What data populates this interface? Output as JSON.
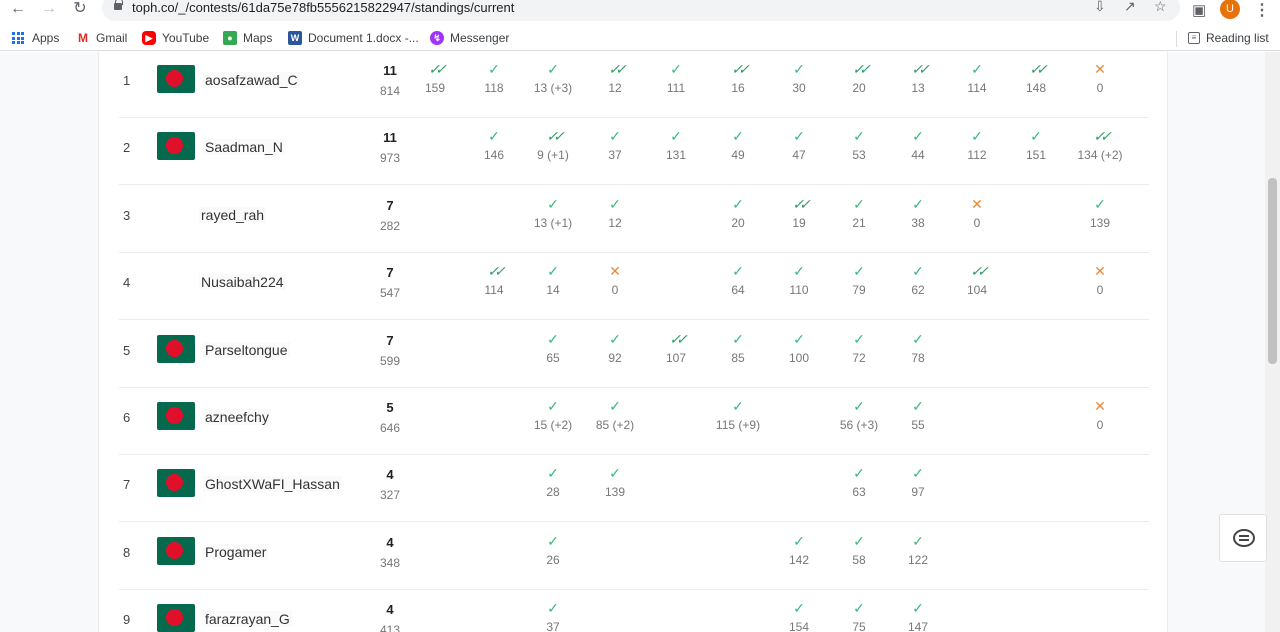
{
  "browser": {
    "url": "toph.co/_/contests/61da75e78fb5556215822947/standings/current",
    "profile_initial": "U",
    "bookmarks": [
      "Apps",
      "Gmail",
      "YouTube",
      "Maps",
      "Document 1.docx -...",
      "Messenger"
    ],
    "reading_list": "Reading list"
  },
  "colors": {
    "accepted": "#3cb87c",
    "first_solve": "#2c9d64",
    "wrong": "#e8893a",
    "flag_green": "#05694d",
    "flag_red": "#e0102b"
  },
  "standings": [
    {
      "rank": "1",
      "name": "aosafzawad_C",
      "flag": true,
      "solved": "11",
      "penalty": "814",
      "cells": [
        {
          "col": 0,
          "status": "first",
          "value": "159"
        },
        {
          "col": 1,
          "status": "ok",
          "value": "118"
        },
        {
          "col": 2,
          "status": "ok",
          "value": "13 (+3)"
        },
        {
          "col": 3,
          "status": "first",
          "value": "12"
        },
        {
          "col": 4,
          "status": "ok",
          "value": "111"
        },
        {
          "col": 5,
          "status": "first",
          "value": "16"
        },
        {
          "col": 6,
          "status": "ok",
          "value": "30"
        },
        {
          "col": 7,
          "status": "first",
          "value": "20"
        },
        {
          "col": 8,
          "status": "first",
          "value": "13"
        },
        {
          "col": 9,
          "status": "ok",
          "value": "114"
        },
        {
          "col": 10,
          "status": "first",
          "value": "148"
        },
        {
          "col": 11,
          "status": "fail",
          "value": "0"
        }
      ]
    },
    {
      "rank": "2",
      "name": "Saadman_N",
      "flag": true,
      "solved": "11",
      "penalty": "973",
      "cells": [
        {
          "col": 1,
          "status": "ok",
          "value": "146"
        },
        {
          "col": 2,
          "status": "first",
          "value": "9 (+1)"
        },
        {
          "col": 3,
          "status": "ok",
          "value": "37"
        },
        {
          "col": 4,
          "status": "ok",
          "value": "131"
        },
        {
          "col": 5,
          "status": "ok",
          "value": "49"
        },
        {
          "col": 6,
          "status": "ok",
          "value": "47"
        },
        {
          "col": 7,
          "status": "ok",
          "value": "53"
        },
        {
          "col": 8,
          "status": "ok",
          "value": "44"
        },
        {
          "col": 9,
          "status": "ok",
          "value": "112"
        },
        {
          "col": 10,
          "status": "ok",
          "value": "151"
        },
        {
          "col": 11,
          "status": "first",
          "value": "134 (+2)"
        }
      ]
    },
    {
      "rank": "3",
      "name": "rayed_rah",
      "flag": false,
      "solved": "7",
      "penalty": "282",
      "cells": [
        {
          "col": 2,
          "status": "ok",
          "value": "13 (+1)"
        },
        {
          "col": 3,
          "status": "ok",
          "value": "12"
        },
        {
          "col": 5,
          "status": "ok",
          "value": "20"
        },
        {
          "col": 6,
          "status": "first",
          "value": "19"
        },
        {
          "col": 7,
          "status": "ok",
          "value": "21"
        },
        {
          "col": 8,
          "status": "ok",
          "value": "38"
        },
        {
          "col": 9,
          "status": "fail",
          "value": "0"
        },
        {
          "col": 11,
          "status": "ok",
          "value": "139"
        }
      ]
    },
    {
      "rank": "4",
      "name": "Nusaibah224",
      "flag": false,
      "solved": "7",
      "penalty": "547",
      "cells": [
        {
          "col": 1,
          "status": "first",
          "value": "114"
        },
        {
          "col": 2,
          "status": "ok",
          "value": "14"
        },
        {
          "col": 3,
          "status": "fail",
          "value": "0"
        },
        {
          "col": 5,
          "status": "ok",
          "value": "64"
        },
        {
          "col": 6,
          "status": "ok",
          "value": "110"
        },
        {
          "col": 7,
          "status": "ok",
          "value": "79"
        },
        {
          "col": 8,
          "status": "ok",
          "value": "62"
        },
        {
          "col": 9,
          "status": "first",
          "value": "104"
        },
        {
          "col": 11,
          "status": "fail",
          "value": "0"
        }
      ]
    },
    {
      "rank": "5",
      "name": "Parseltongue",
      "flag": true,
      "solved": "7",
      "penalty": "599",
      "cells": [
        {
          "col": 2,
          "status": "ok",
          "value": "65"
        },
        {
          "col": 3,
          "status": "ok",
          "value": "92"
        },
        {
          "col": 4,
          "status": "first",
          "value": "107"
        },
        {
          "col": 5,
          "status": "ok",
          "value": "85"
        },
        {
          "col": 6,
          "status": "ok",
          "value": "100"
        },
        {
          "col": 7,
          "status": "ok",
          "value": "72"
        },
        {
          "col": 8,
          "status": "ok",
          "value": "78"
        }
      ]
    },
    {
      "rank": "6",
      "name": "azneefchy",
      "flag": true,
      "solved": "5",
      "penalty": "646",
      "cells": [
        {
          "col": 2,
          "status": "ok",
          "value": "15 (+2)"
        },
        {
          "col": 3,
          "status": "ok",
          "value": "85 (+2)"
        },
        {
          "col": 5,
          "status": "ok",
          "value": "115 (+9)"
        },
        {
          "col": 7,
          "status": "ok",
          "value": "56 (+3)"
        },
        {
          "col": 8,
          "status": "ok",
          "value": "55"
        },
        {
          "col": 11,
          "status": "fail",
          "value": "0"
        }
      ]
    },
    {
      "rank": "7",
      "name": "GhostXWaFI_Hassan",
      "flag": true,
      "solved": "4",
      "penalty": "327",
      "cells": [
        {
          "col": 2,
          "status": "ok",
          "value": "28"
        },
        {
          "col": 3,
          "status": "ok",
          "value": "139"
        },
        {
          "col": 7,
          "status": "ok",
          "value": "63"
        },
        {
          "col": 8,
          "status": "ok",
          "value": "97"
        }
      ]
    },
    {
      "rank": "8",
      "name": "Progamer",
      "flag": true,
      "solved": "4",
      "penalty": "348",
      "cells": [
        {
          "col": 2,
          "status": "ok",
          "value": "26"
        },
        {
          "col": 6,
          "status": "ok",
          "value": "142"
        },
        {
          "col": 7,
          "status": "ok",
          "value": "58"
        },
        {
          "col": 8,
          "status": "ok",
          "value": "122"
        }
      ]
    },
    {
      "rank": "9",
      "name": "farazrayan_G",
      "flag": true,
      "solved": "4",
      "penalty": "413",
      "cells": [
        {
          "col": 2,
          "status": "ok",
          "value": "37"
        },
        {
          "col": 6,
          "status": "ok",
          "value": "154"
        },
        {
          "col": 7,
          "status": "ok",
          "value": "75"
        },
        {
          "col": 8,
          "status": "ok",
          "value": "147"
        }
      ]
    }
  ]
}
